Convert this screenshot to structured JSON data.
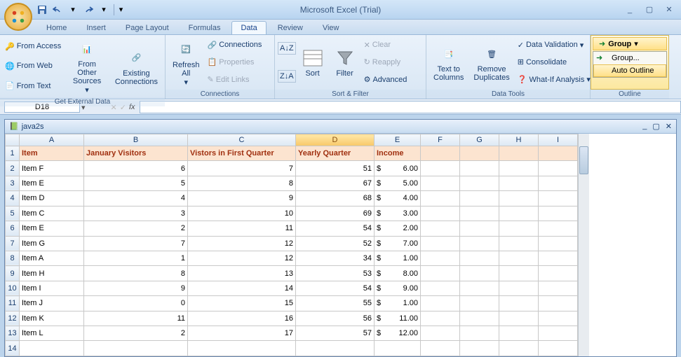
{
  "app": {
    "title": "Microsoft Excel (Trial)"
  },
  "qat": {
    "save": "save",
    "undo": "undo",
    "redo": "redo"
  },
  "tabs": [
    "Home",
    "Insert",
    "Page Layout",
    "Formulas",
    "Data",
    "Review",
    "View"
  ],
  "active_tab": "Data",
  "ribbon": {
    "get_external_data": {
      "label": "Get External Data",
      "from_access": "From Access",
      "from_web": "From Web",
      "from_text": "From Text",
      "from_other": "From Other\nSources",
      "existing": "Existing\nConnections"
    },
    "connections": {
      "label": "Connections",
      "refresh": "Refresh\nAll",
      "connections_btn": "Connections",
      "properties": "Properties",
      "edit_links": "Edit Links"
    },
    "sort_filter": {
      "label": "Sort & Filter",
      "sort": "Sort",
      "filter": "Filter",
      "clear": "Clear",
      "reapply": "Reapply",
      "advanced": "Advanced"
    },
    "data_tools": {
      "label": "Data Tools",
      "text_to_columns": "Text to\nColumns",
      "remove_duplicates": "Remove\nDuplicates",
      "data_validation": "Data Validation",
      "consolidate": "Consolidate",
      "what_if": "What-If Analysis"
    },
    "outline": {
      "label": "Outline",
      "group": "Group",
      "menu_group": "Group...",
      "menu_auto": "Auto Outline"
    }
  },
  "namebox": "D18",
  "workbook": "java2s",
  "columns": [
    "A",
    "B",
    "C",
    "D",
    "E",
    "F",
    "G",
    "H",
    "I"
  ],
  "headers": {
    "A": "Item",
    "B": "January Visitors",
    "C": "Vistors in First Quarter",
    "D": "Yearly Quarter",
    "E": "Income"
  },
  "rows": [
    {
      "n": 2,
      "A": "Item F",
      "B": "6",
      "C": "7",
      "D": "51",
      "E": "6.00"
    },
    {
      "n": 3,
      "A": "Item E",
      "B": "5",
      "C": "8",
      "D": "67",
      "E": "5.00"
    },
    {
      "n": 4,
      "A": "Item D",
      "B": "4",
      "C": "9",
      "D": "68",
      "E": "4.00"
    },
    {
      "n": 5,
      "A": "Item C",
      "B": "3",
      "C": "10",
      "D": "69",
      "E": "3.00"
    },
    {
      "n": 6,
      "A": "Item E",
      "B": "2",
      "C": "11",
      "D": "54",
      "E": "2.00"
    },
    {
      "n": 7,
      "A": "Item G",
      "B": "7",
      "C": "12",
      "D": "52",
      "E": "7.00"
    },
    {
      "n": 8,
      "A": "Item A",
      "B": "1",
      "C": "12",
      "D": "34",
      "E": "1.00"
    },
    {
      "n": 9,
      "A": "Item H",
      "B": "8",
      "C": "13",
      "D": "53",
      "E": "8.00"
    },
    {
      "n": 10,
      "A": "Item I",
      "B": "9",
      "C": "14",
      "D": "54",
      "E": "9.00"
    },
    {
      "n": 11,
      "A": "Item J",
      "B": "0",
      "C": "15",
      "D": "55",
      "E": "1.00"
    },
    {
      "n": 12,
      "A": "Item K",
      "B": "11",
      "C": "16",
      "D": "56",
      "E": "11.00"
    },
    {
      "n": 13,
      "A": "Item L",
      "B": "2",
      "C": "17",
      "D": "57",
      "E": "12.00"
    }
  ],
  "empty_rows": [
    14
  ],
  "chart_data": {
    "type": "table",
    "columns": [
      "Item",
      "January Visitors",
      "Vistors in First Quarter",
      "Yearly Quarter",
      "Income"
    ],
    "data": [
      [
        "Item F",
        6,
        7,
        51,
        6.0
      ],
      [
        "Item E",
        5,
        8,
        67,
        5.0
      ],
      [
        "Item D",
        4,
        9,
        68,
        4.0
      ],
      [
        "Item C",
        3,
        10,
        69,
        3.0
      ],
      [
        "Item E",
        2,
        11,
        54,
        2.0
      ],
      [
        "Item G",
        7,
        12,
        52,
        7.0
      ],
      [
        "Item A",
        1,
        12,
        34,
        1.0
      ],
      [
        "Item H",
        8,
        13,
        53,
        8.0
      ],
      [
        "Item I",
        9,
        14,
        54,
        9.0
      ],
      [
        "Item J",
        0,
        15,
        55,
        1.0
      ],
      [
        "Item K",
        11,
        16,
        56,
        11.0
      ],
      [
        "Item L",
        2,
        17,
        57,
        12.0
      ]
    ]
  }
}
